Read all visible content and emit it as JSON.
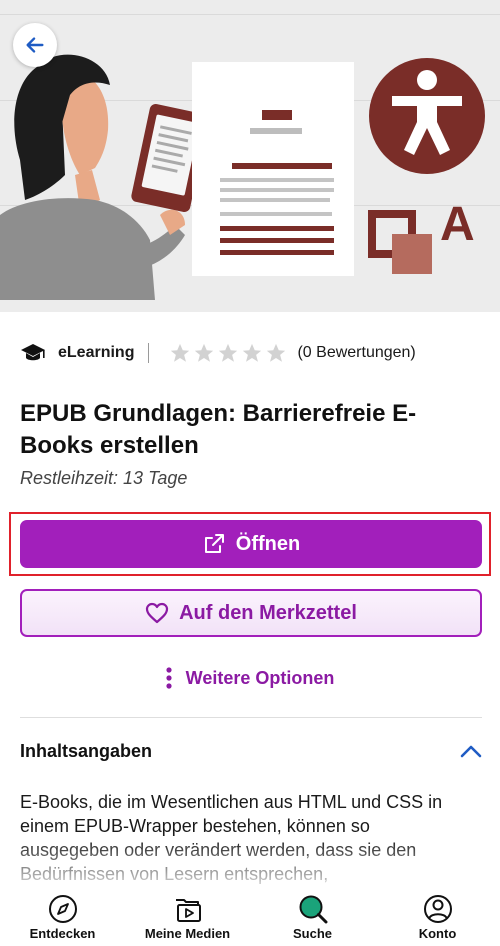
{
  "hero": {
    "image_alt": "Illustration: Person mit E-Book-Reader, Dokument und Barrierefreiheitssymbol"
  },
  "meta": {
    "type_label": "eLearning",
    "rating_text": "(0 Bewertungen)",
    "stars_filled": 0,
    "stars_total": 5
  },
  "title": "EPUB Grundlagen: Barrierefreie E-Books erstellen",
  "loan_time": "Restleihzeit: 13 Tage",
  "actions": {
    "open_label": "Öffnen",
    "wishlist_label": "Auf den Merkzettel",
    "more_options_label": "Weitere Optionen"
  },
  "section": {
    "title": "Inhaltsangaben",
    "description": "E-Books, die im Wesentlichen aus HTML und CSS in einem EPUB-Wrapper bestehen, können so ausgegeben oder verändert werden, dass sie den Bedürfnissen von Lesern entsprechen,"
  },
  "nav": [
    {
      "label": "Entdecken",
      "icon": "compass-icon"
    },
    {
      "label": "Meine Medien",
      "icon": "media-icon"
    },
    {
      "label": "Suche",
      "icon": "search-icon"
    },
    {
      "label": "Konto",
      "icon": "account-icon"
    }
  ],
  "colors": {
    "accent": "#a21fbb",
    "accent_text": "#8b1aa3",
    "focus_outline": "#e0212b",
    "link_blue": "#1f5cc4",
    "search_green": "#1aa37a",
    "illustration_brown": "#7a2d28"
  }
}
